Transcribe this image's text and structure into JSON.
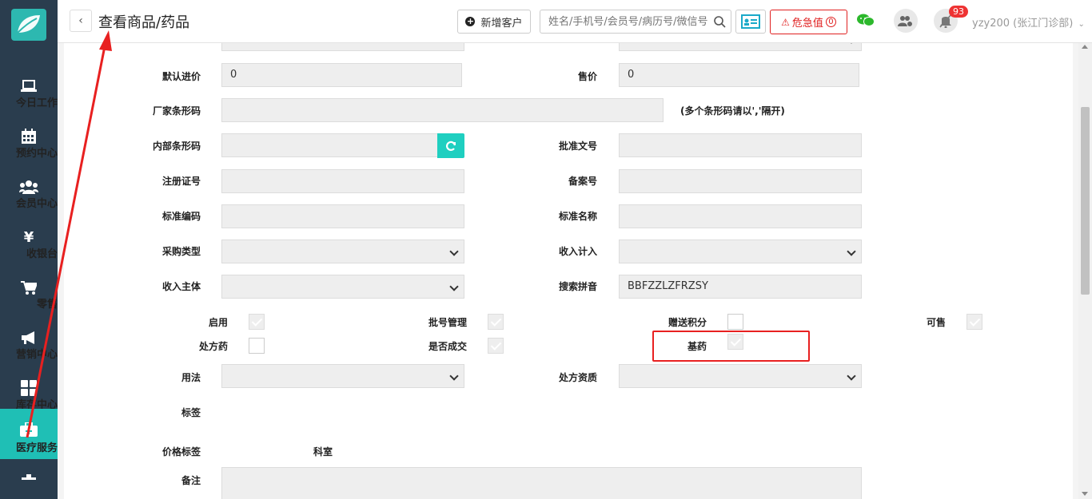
{
  "sidebar": {
    "items": [
      {
        "label": "今日工作",
        "icon": "laptop-icon"
      },
      {
        "label": "预约中心",
        "icon": "calendar-icon"
      },
      {
        "label": "会员中心",
        "icon": "users-icon"
      },
      {
        "label": "收银台",
        "icon": "yen-icon"
      },
      {
        "label": "零售",
        "icon": "cart-icon"
      },
      {
        "label": "营销中心",
        "icon": "megaphone-icon"
      },
      {
        "label": "库存中心",
        "icon": "grid-icon"
      },
      {
        "label": "医疗服务",
        "icon": "medkit-icon",
        "active": true
      }
    ]
  },
  "header": {
    "title": "查看商品/药品",
    "new_customer": "新增客户",
    "search_placeholder": "姓名/手机号/会员号/病历号/微信号",
    "danger_label": "危急值",
    "danger_count": "0",
    "notify_count": "93",
    "user": "yzy200 (张江门诊部)"
  },
  "form": {
    "default_cost_label": "默认进价",
    "default_cost": "0",
    "price_label": "售价",
    "price": "0",
    "barcode_label": "厂家条形码",
    "barcode_note": "(多个条形码请以','隔开)",
    "internal_code_label": "内部条形码",
    "approval_no_label": "批准文号",
    "reg_cert_label": "注册证号",
    "filing_no_label": "备案号",
    "std_code_label": "标准编码",
    "std_name_label": "标准名称",
    "purchase_type_label": "采购类型",
    "income_count_label": "收入计入",
    "income_subject_label": "收入主体",
    "pinyin_label": "搜索拼音",
    "pinyin": "BBFZZLZFRZSY",
    "enabled_label": "启用",
    "batch_label": "批号管理",
    "points_label": "赠送积分",
    "sellable_label": "可售",
    "rx_label": "处方药",
    "deal_label": "是否成交",
    "base_drug_label": "基药",
    "usage_label": "用法",
    "rx_qual_label": "处方资质",
    "tag_label": "标签",
    "price_tag_label": "价格标签",
    "dept_label": "科室",
    "remark_label": "备注"
  },
  "colors": {
    "sidebar_bg": "#2a3d4e",
    "accent": "#1fbfb5",
    "danger": "#e02020"
  }
}
